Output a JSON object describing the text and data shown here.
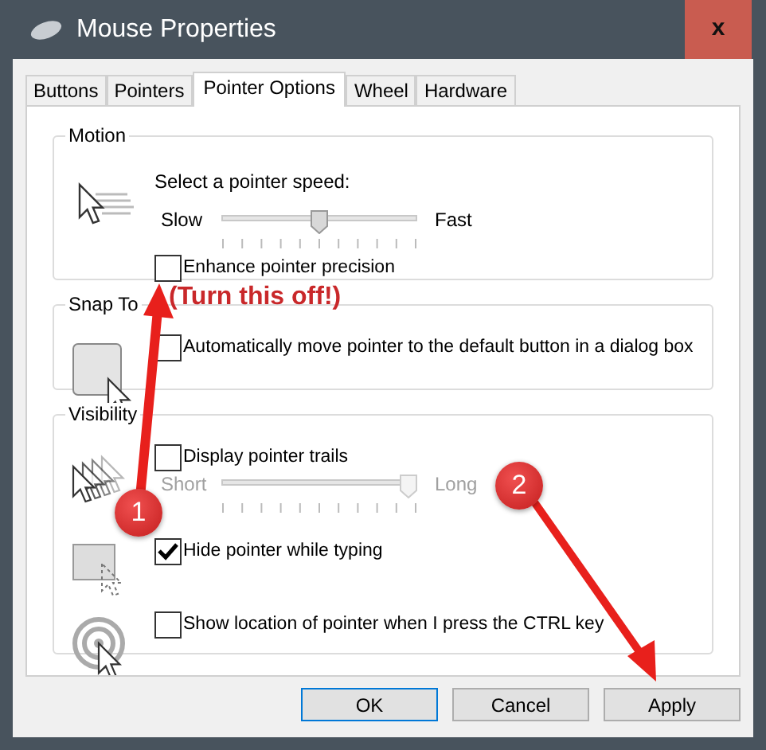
{
  "window": {
    "title": "Mouse Properties",
    "close": "x"
  },
  "tabs": [
    {
      "label": "Buttons",
      "selected": false
    },
    {
      "label": "Pointers",
      "selected": false
    },
    {
      "label": "Pointer Options",
      "selected": true
    },
    {
      "label": "Wheel",
      "selected": false
    },
    {
      "label": "Hardware",
      "selected": false
    }
  ],
  "groups": [
    {
      "title": "Motion",
      "sections": [
        {
          "rows": [
            {
              "kind": "label",
              "text": "Select a pointer speed:"
            },
            {
              "kind": "slider",
              "min_label": "Slow",
              "max_label": "Fast",
              "level": 0.5,
              "disabled": false
            },
            {
              "kind": "checkbox",
              "label": "Enhance pointer precision",
              "checked": false
            }
          ]
        }
      ]
    },
    {
      "title": "Snap To",
      "sections": [
        {
          "rows": [
            {
              "kind": "checkbox",
              "label": "Automatically move pointer to the default button in a dialog box",
              "checked": false
            }
          ]
        }
      ]
    },
    {
      "title": "Visibility",
      "sections": [
        {
          "rows": [
            {
              "kind": "checkbox",
              "label": "Display pointer trails",
              "checked": false
            },
            {
              "kind": "slider",
              "min_label": "Short",
              "max_label": "Long",
              "level": 1,
              "disabled": true
            }
          ]
        },
        {
          "rows": [
            {
              "kind": "checkbox",
              "label": "Hide pointer while typing",
              "checked": true
            }
          ]
        },
        {
          "rows": [
            {
              "kind": "checkbox",
              "label": "Show location of pointer when I press the CTRL key",
              "checked": false
            }
          ]
        }
      ]
    }
  ],
  "buttons": [
    {
      "label": "OK",
      "default": true
    },
    {
      "label": "Cancel",
      "default": false
    },
    {
      "label": "Apply",
      "default": false
    }
  ],
  "annotations": [
    {
      "kind": "callout",
      "text": "(Turn this off!)"
    },
    {
      "kind": "badge",
      "text": "1"
    },
    {
      "kind": "badge",
      "text": "2"
    }
  ]
}
